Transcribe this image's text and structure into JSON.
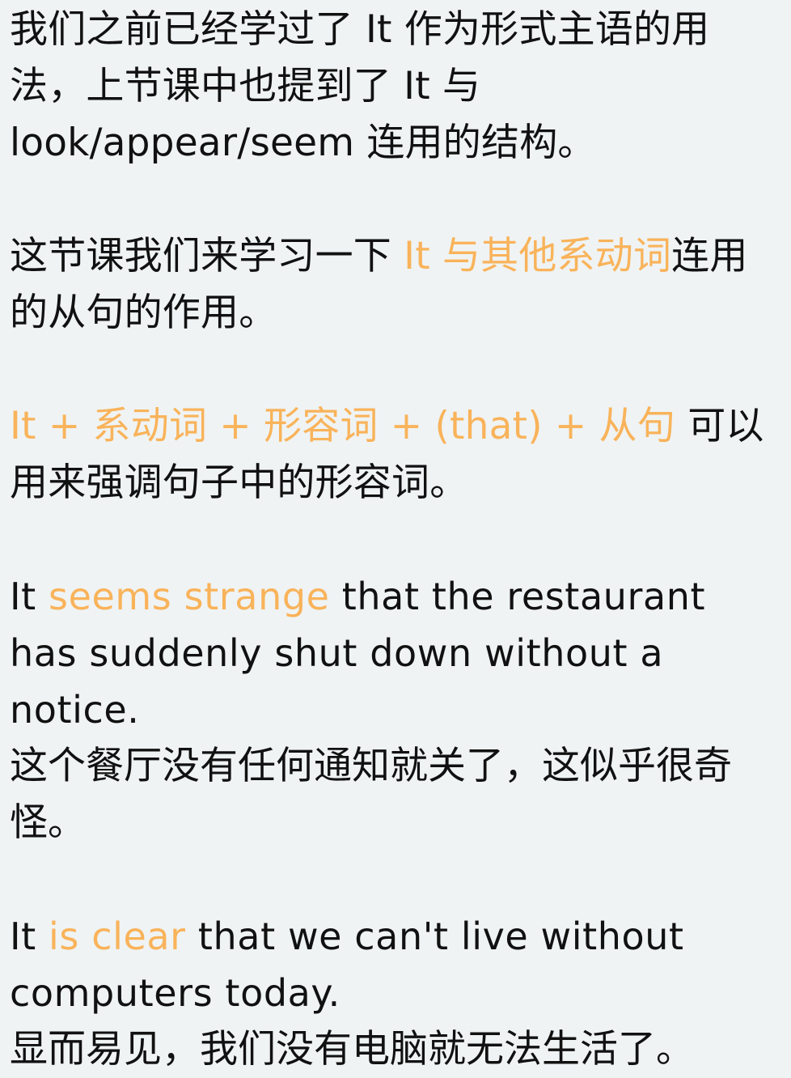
{
  "paragraphs": {
    "intro": "我们之前已经学过了 It 作为形式主语的用法，上节课中也提到了 It 与 look/appear/seem 连用的结构。",
    "lesson": {
      "before": "这节课我们来学习一下 ",
      "highlight": "It 与其他系动词",
      "after": "连用的从句的作用。"
    },
    "pattern": {
      "highlight": "It + 系动词 + 形容词 + (that) + 从句",
      "after": " 可以用来强调句子中的形容词。"
    }
  },
  "examples": [
    {
      "before": "It ",
      "highlight": "seems strange",
      "after": " that the restaurant has suddenly shut down without a notice.",
      "translation": "这个餐厅没有任何通知就关了，这似乎很奇怪。"
    },
    {
      "before": "It ",
      "highlight": "is clear",
      "after": " that we can't live without computers today.",
      "translation": "显而易见，我们没有电脑就无法生活了。"
    }
  ],
  "colors": {
    "background": "#eff3f4",
    "text": "#111111",
    "highlight": "#f9b35a"
  }
}
